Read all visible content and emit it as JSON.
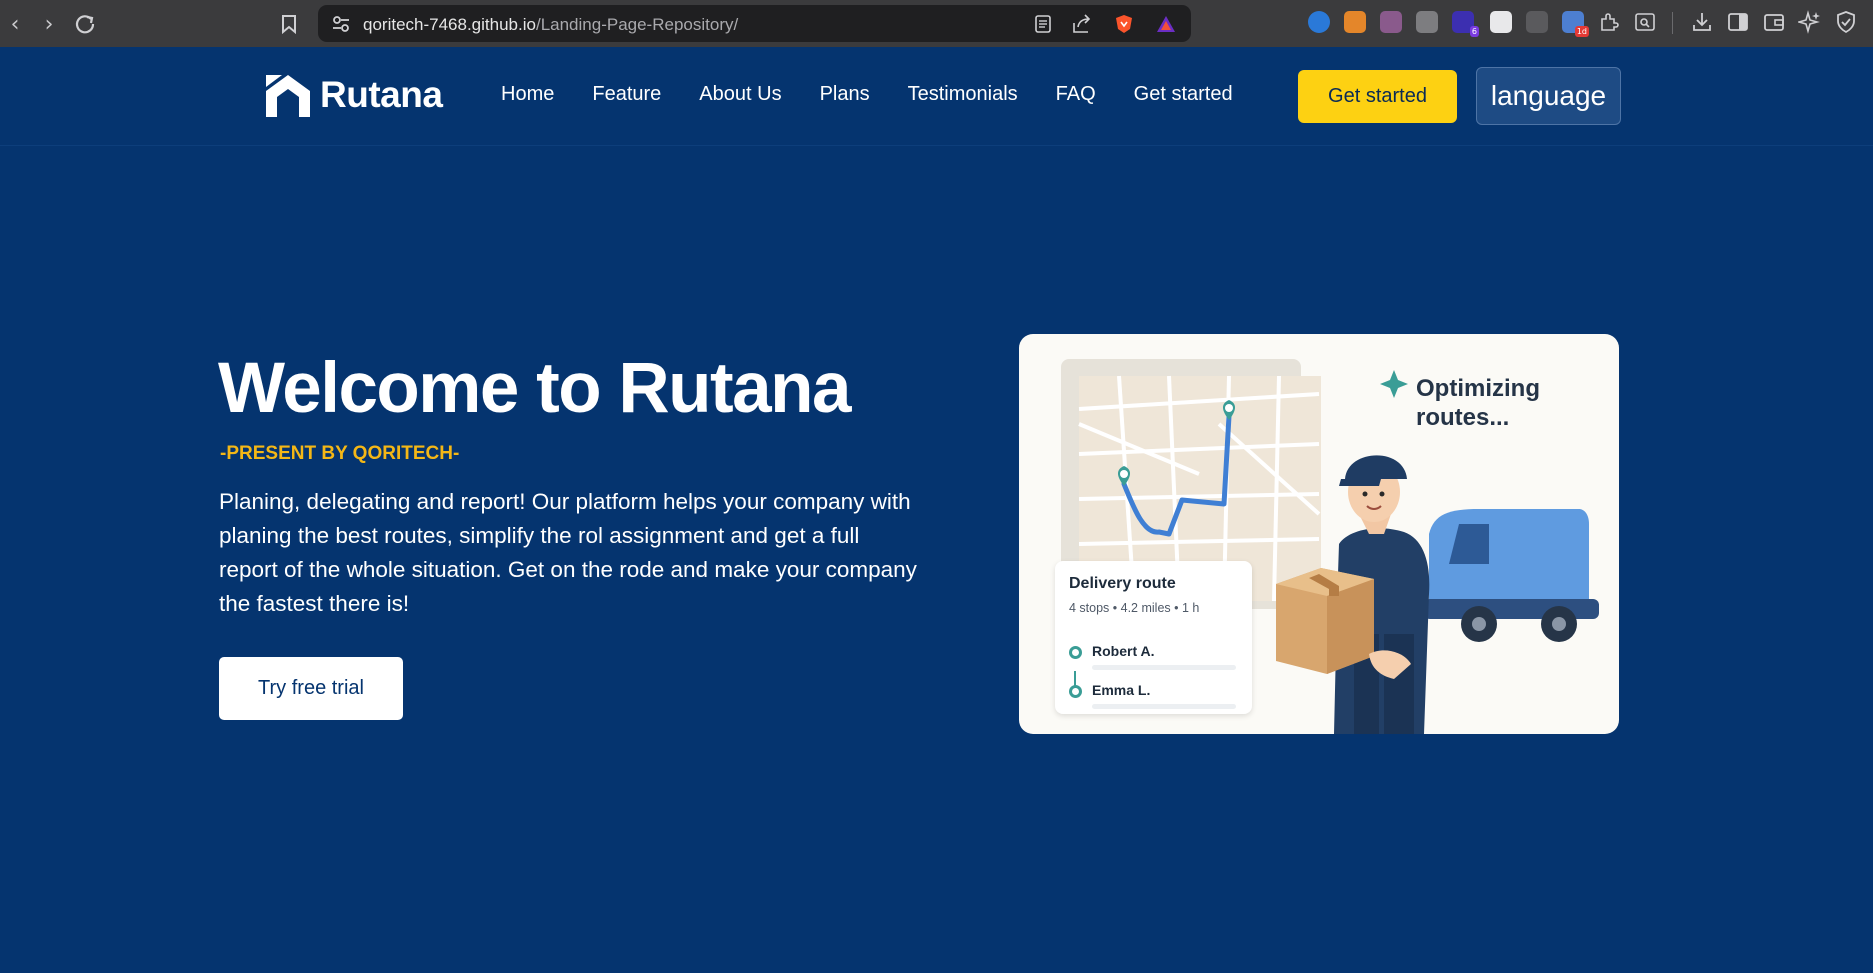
{
  "browser": {
    "url_host": "qoritech-7468.github.io",
    "url_path": "/Landing-Page-Repository/",
    "icons": [
      "back-icon",
      "forward-icon",
      "reload-icon",
      "bookmark-icon",
      "site-settings-icon",
      "reader-mode-icon",
      "share-icon",
      "brave-shields-icon",
      "brave-rewards-icon",
      "extensions-icon",
      "downloads-icon",
      "sidebar-icon",
      "wallet-icon",
      "leo-ai-icon",
      "vpn-icon"
    ],
    "extension_badges": [
      "6",
      "1d"
    ]
  },
  "header": {
    "brand": "Rutana",
    "nav": [
      "Home",
      "Feature",
      "About Us",
      "Plans",
      "Testimonials",
      "FAQ",
      "Get started"
    ],
    "cta_label": "Get started",
    "language_label": "language"
  },
  "hero": {
    "title": "Welcome to Rutana",
    "subtitle": "-PRESENT BY QORITECH-",
    "description": "Planing, delegating and report! Our platform helps your company with planing the best routes, simplify the rol assignment and get a full report of the whole situation. Get on the rode and make your company the fastest there is!",
    "button_label": "Try free trial"
  },
  "illustration": {
    "optimizing_label": "Optimizing routes...",
    "route_card": {
      "title": "Delivery route",
      "meta": "4 stops • 4.2 miles • 1 h",
      "stops": [
        "Robert A.",
        "Emma L."
      ]
    }
  },
  "colors": {
    "page_bg": "#05346f",
    "accent_yellow": "#fdd112",
    "subtitle_orange": "#f4b716",
    "teal": "#3a9d96"
  }
}
